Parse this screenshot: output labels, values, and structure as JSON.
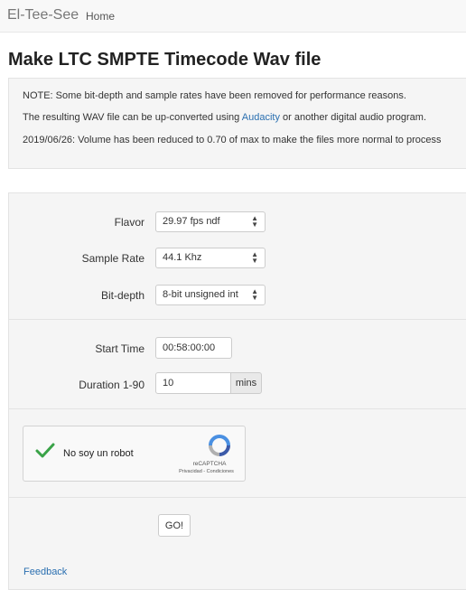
{
  "navbar": {
    "brand": "El-Tee-See",
    "home": "Home"
  },
  "page_title": "Make LTC SMPTE Timecode Wav file",
  "notes": {
    "line1": "NOTE: Some bit-depth and sample rates have been removed for performance reasons.",
    "line2_before": "The resulting WAV file can be up-converted using ",
    "line2_link": "Audacity",
    "line2_after": " or another digital audio program.",
    "line3": "2019/06/26: Volume has been reduced to 0.70 of max to make the files more normal to process"
  },
  "form": {
    "flavor": {
      "label": "Flavor",
      "value": "29.97 fps ndf"
    },
    "sample_rate": {
      "label": "Sample Rate",
      "value": "44.1 Khz"
    },
    "bit_depth": {
      "label": "Bit-depth",
      "value": "8-bit unsigned int"
    },
    "start_time": {
      "label": "Start Time",
      "value": "00:58:00:00"
    },
    "duration": {
      "label": "Duration 1-90",
      "value": "10",
      "addon": "mins"
    },
    "captcha": {
      "label": "No soy un robot",
      "brand": "reCAPTCHA",
      "links": "Privacidad - Condiciones"
    },
    "go_label": "GO!"
  },
  "feedback": "Feedback",
  "colors": {
    "link": "#2a6fb0",
    "check": "#3aa348",
    "well": "#f5f5f5"
  }
}
